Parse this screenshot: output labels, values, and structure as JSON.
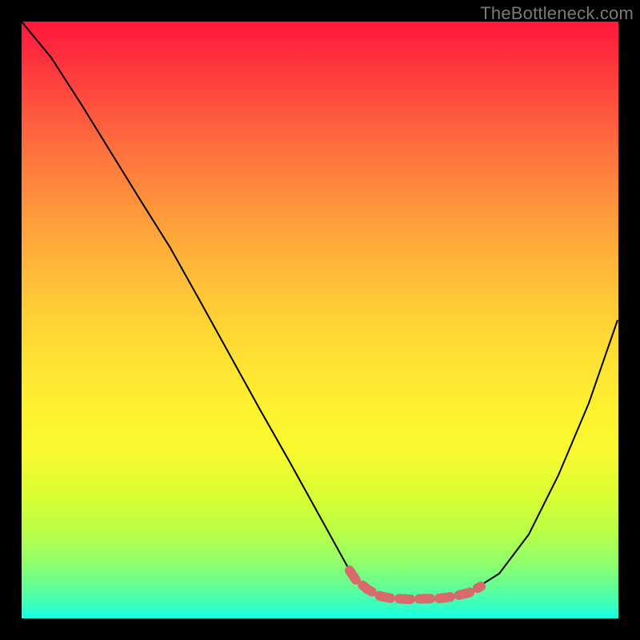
{
  "watermark": "TheBottleneck.com",
  "chart_data": {
    "type": "line",
    "title": "",
    "xlabel": "",
    "ylabel": "",
    "xlim": [
      0,
      100
    ],
    "ylim": [
      0,
      100
    ],
    "series": [
      {
        "name": "curve",
        "x": [
          0,
          5,
          10,
          15,
          20,
          25,
          30,
          35,
          40,
          45,
          50,
          55,
          56,
          58,
          60,
          62,
          65,
          70,
          72,
          75,
          80,
          85,
          90,
          95,
          100
        ],
        "y": [
          100,
          94,
          86,
          78,
          70,
          62,
          53,
          44,
          35,
          26,
          17,
          8,
          6.5,
          4.8,
          3.8,
          3.4,
          3.3,
          3.4,
          3.6,
          4.3,
          7.5,
          14,
          24,
          36,
          50
        ]
      },
      {
        "name": "highlight",
        "x": [
          55,
          56,
          58,
          60,
          62,
          65,
          70,
          72,
          75,
          77
        ],
        "y": [
          8,
          6.5,
          4.8,
          3.8,
          3.4,
          3.3,
          3.4,
          3.6,
          4.3,
          5.4
        ]
      }
    ],
    "colors": {
      "curve": "#000000",
      "highlight": "#d76b6b"
    }
  }
}
